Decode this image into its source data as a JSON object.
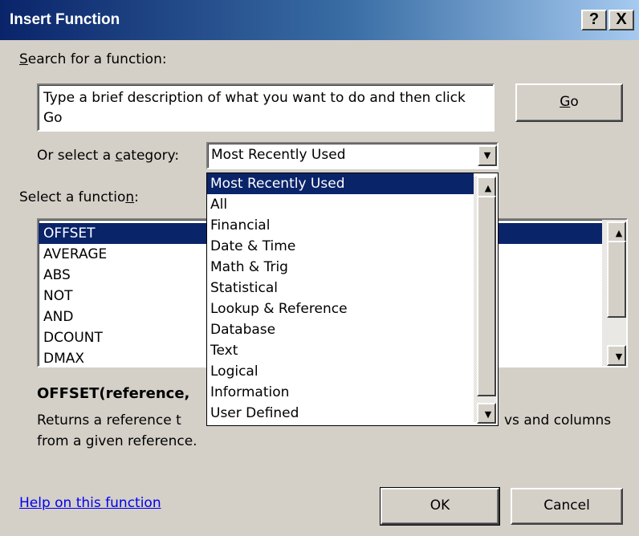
{
  "window": {
    "title": "Insert Function",
    "help_btn": "?",
    "close_btn": "X"
  },
  "search": {
    "label_pre": "",
    "label_key": "S",
    "label_post": "earch for a function:",
    "value": "Type a brief description of what you want to do and then click Go",
    "go_pre": "",
    "go_key": "G",
    "go_post": "o"
  },
  "category": {
    "label_pre": "Or select a ",
    "label_key": "c",
    "label_post": "ategory:",
    "selected": "Most Recently Used",
    "options": [
      "Most Recently Used",
      "All",
      "Financial",
      "Date & Time",
      "Math & Trig",
      "Statistical",
      "Lookup & Reference",
      "Database",
      "Text",
      "Logical",
      "Information",
      "User Defined"
    ]
  },
  "functions": {
    "label_pre": "Select a functio",
    "label_key": "n",
    "label_post": ":",
    "items": [
      "OFFSET",
      "AVERAGE",
      "ABS",
      "NOT",
      "AND",
      "DCOUNT",
      "DMAX"
    ],
    "selected_index": 0
  },
  "description": {
    "signature": "OFFSET(reference,",
    "text_start": "Returns a reference t",
    "text_end": "vs and columns",
    "text_line2": "from a given reference."
  },
  "footer": {
    "help_link": "Help on this function",
    "ok": "OK",
    "cancel": "Cancel"
  },
  "colors": {
    "face": "#d4d0c8",
    "selection": "#0a246a",
    "link": "#0000ee"
  }
}
